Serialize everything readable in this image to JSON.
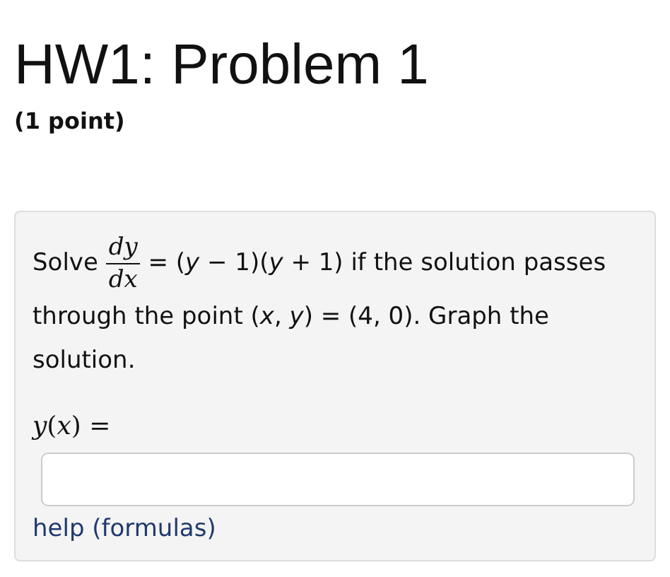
{
  "title": "HW1: Problem 1",
  "points": "(1 point)",
  "problem": {
    "lead": "Solve",
    "fraction": {
      "numerator": "*dy*",
      "denominator": "*dx*"
    },
    "rest": "= (*y* − 1)(*y* + 1) if the solution passes through the point (*x*, *y*) = (4, 0). Graph the solution."
  },
  "answer": {
    "label": "*y*(*x*) ="
  },
  "help_link": "help (formulas)"
}
